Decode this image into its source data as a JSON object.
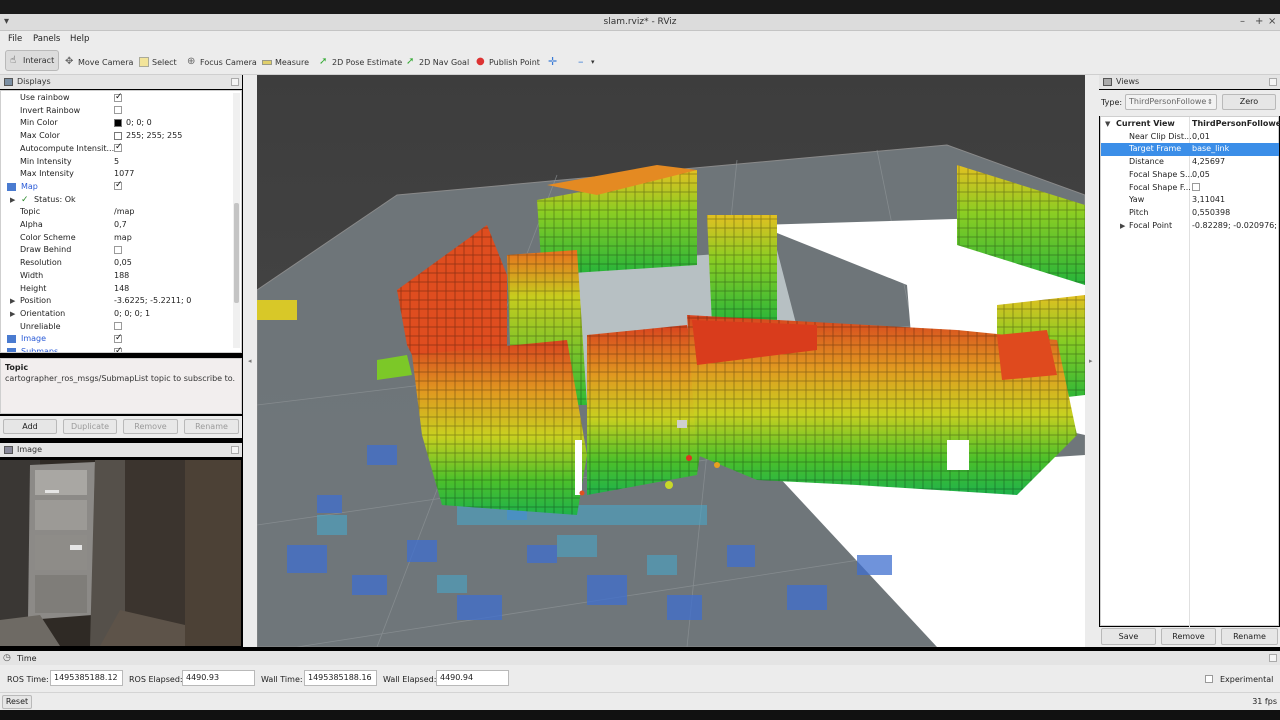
{
  "window": {
    "title": "slam.rviz* - RViz"
  },
  "menu": [
    "File",
    "Panels",
    "Help"
  ],
  "toolbar": {
    "interact": "Interact",
    "move_camera": "Move Camera",
    "select": "Select",
    "focus_camera": "Focus Camera",
    "measure": "Measure",
    "pose_estimate": "2D Pose Estimate",
    "nav_goal": "2D Nav Goal",
    "publish_point": "Publish Point"
  },
  "displays": {
    "title": "Displays",
    "rows": [
      {
        "key": "Use rainbow",
        "check": true
      },
      {
        "key": "Invert Rainbow",
        "check": false
      },
      {
        "key": "Min Color",
        "value": "0; 0; 0",
        "swatch": "#000000"
      },
      {
        "key": "Max Color",
        "value": "255; 255; 255",
        "swatch": "#ffffff"
      },
      {
        "key": "Autocompute Intensit...",
        "check": true
      },
      {
        "key": "Min Intensity",
        "value": "5"
      },
      {
        "key": "Max Intensity",
        "value": "1077"
      },
      {
        "key": "Map",
        "check": true,
        "group": true
      },
      {
        "key": "Status: Ok",
        "status": true
      },
      {
        "key": "Topic",
        "value": "/map"
      },
      {
        "key": "Alpha",
        "value": "0,7"
      },
      {
        "key": "Color Scheme",
        "value": "map"
      },
      {
        "key": "Draw Behind",
        "check": false
      },
      {
        "key": "Resolution",
        "value": "0,05"
      },
      {
        "key": "Width",
        "value": "188"
      },
      {
        "key": "Height",
        "value": "148"
      },
      {
        "key": "Position",
        "value": "-3.6225; -5.2211; 0",
        "expand": true
      },
      {
        "key": "Orientation",
        "value": "0; 0; 0; 1",
        "expand": true
      },
      {
        "key": "Unreliable",
        "check": false
      },
      {
        "key": "Image",
        "check": true,
        "group": true
      },
      {
        "key": "Submaps",
        "check": true,
        "group": true
      }
    ],
    "desc_title": "Topic",
    "desc_text": "cartographer_ros_msgs/SubmapList topic to subscribe to.",
    "buttons": {
      "add": "Add",
      "duplicate": "Duplicate",
      "remove": "Remove",
      "rename": "Rename"
    }
  },
  "image_panel": {
    "title": "Image"
  },
  "views": {
    "title": "Views",
    "type_label": "Type:",
    "type_value": "ThirdPersonFollowe",
    "zero": "Zero",
    "rows": [
      {
        "key": "Current View",
        "value": "ThirdPersonFollowe...",
        "header": true
      },
      {
        "key": "Near Clip Dist...",
        "value": "0,01"
      },
      {
        "key": "Target Frame",
        "value": "base_link",
        "selected": true
      },
      {
        "key": "Distance",
        "value": "4,25697"
      },
      {
        "key": "Focal Shape S...",
        "value": "0,05"
      },
      {
        "key": "Focal Shape F...",
        "check": false
      },
      {
        "key": "Yaw",
        "value": "3,11041"
      },
      {
        "key": "Pitch",
        "value": "0,550398"
      },
      {
        "key": "Focal Point",
        "value": "-0.82289; -0.020976; ...",
        "expand": true
      }
    ],
    "buttons": {
      "save": "Save",
      "remove": "Remove",
      "rename": "Rename"
    }
  },
  "time": {
    "title": "Time",
    "ros_time_label": "ROS Time:",
    "ros_time": "1495385188.12",
    "ros_elapsed_label": "ROS Elapsed:",
    "ros_elapsed": "4490.93",
    "wall_time_label": "Wall Time:",
    "wall_time": "1495385188.16",
    "wall_elapsed_label": "Wall Elapsed:",
    "wall_elapsed": "4490.94",
    "experimental": "Experimental",
    "reset": "Reset",
    "fps": "31 fps"
  }
}
